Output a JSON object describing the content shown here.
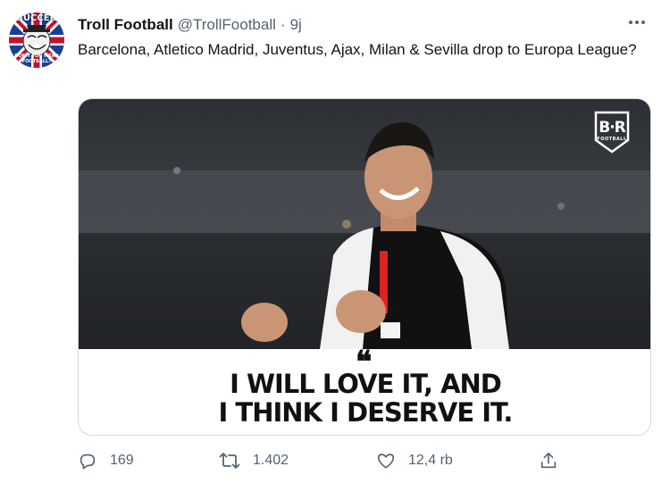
{
  "avatar": {
    "top_text": "SUCCER",
    "bottom_text_1": "DON'T YOU MEAN",
    "bottom_text_2": "FOOTBALL?"
  },
  "tweet": {
    "display_name": "Troll Football",
    "handle": "@TrollFootball",
    "separator": "·",
    "time": "9j",
    "text": "Barcelona, Atletico Madrid, Juventus, Ajax, Milan & Sevilla drop to Europa League?"
  },
  "media": {
    "logo_text": "B·R",
    "logo_sub": "FOOTBALL",
    "quote_mark": "❝",
    "quote_line_1": "I WILL LOVE IT, AND",
    "quote_line_2": "I THINK I DESERVE IT."
  },
  "actions": {
    "replies": "169",
    "retweets": "1.402",
    "likes": "12,4 rb"
  },
  "colors": {
    "text": "#0f1419",
    "secondary": "#536471",
    "border": "#cfd9de"
  },
  "icons": [
    "more-icon",
    "reply-icon",
    "retweet-icon",
    "like-icon",
    "share-icon"
  ]
}
